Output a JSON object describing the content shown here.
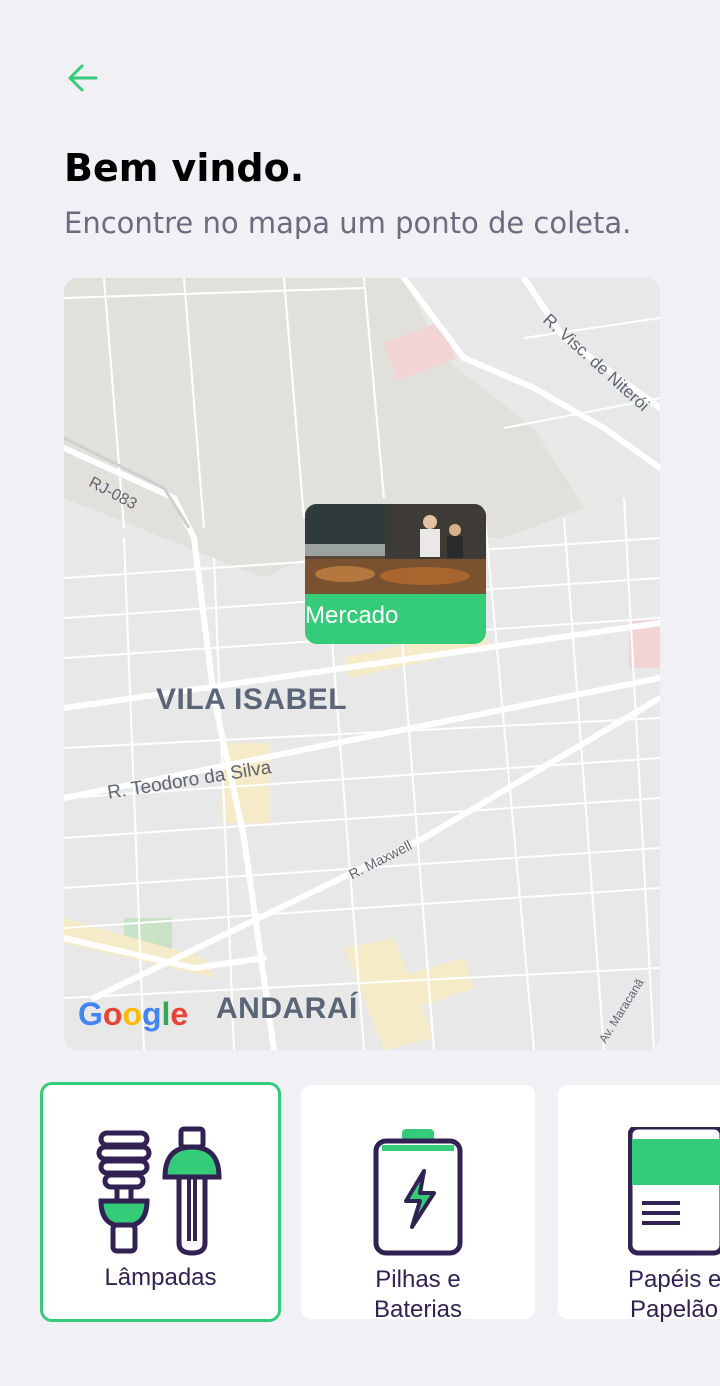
{
  "header": {
    "title": "Bem vindo.",
    "subtitle": "Encontre no mapa um ponto de coleta."
  },
  "colors": {
    "accent": "#34CB79",
    "title": "#000000",
    "subtitle": "#6C6C80",
    "item_text": "#322153",
    "background": "#F0F0F5"
  },
  "map": {
    "labels": {
      "vila_isabel": "VILA ISABEL",
      "andarai": "ANDARAÍ",
      "rj083": "RJ-083",
      "teodoro": "R. Teodoro da Silva",
      "maxwell": "R. Maxwell",
      "visc": "R. Visc. de Niterói",
      "maracana": "Av. Maracanã"
    },
    "attribution": "Google",
    "marker": {
      "label": "Mercado"
    }
  },
  "items": [
    {
      "label_line1": "Lâmpadas",
      "label_line2": "",
      "icon": "lamp-icon",
      "selected": true
    },
    {
      "label_line1": "Pilhas e",
      "label_line2": "Baterias",
      "icon": "battery-icon",
      "selected": false
    },
    {
      "label_line1": "Papéis e",
      "label_line2": "Papelão",
      "icon": "paper-icon",
      "selected": false
    }
  ]
}
